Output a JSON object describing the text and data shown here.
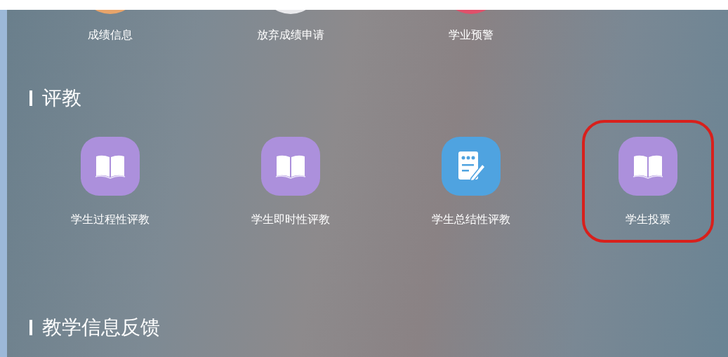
{
  "top_items": [
    {
      "label": "成绩信息",
      "color": "#e8a46a"
    },
    {
      "label": "放弃成绩申请",
      "color": "#e9e9ec"
    },
    {
      "label": "学业预警",
      "color": "#e0506a"
    }
  ],
  "sections": [
    {
      "title": "评教",
      "items": [
        {
          "label": "学生过程性评教",
          "kind": "book",
          "color": "#ac90dc",
          "highlighted": false
        },
        {
          "label": "学生即时性评教",
          "kind": "book",
          "color": "#ac90dc",
          "highlighted": false
        },
        {
          "label": "学生总结性评教",
          "kind": "form",
          "color": "#4fa3e0",
          "highlighted": false
        },
        {
          "label": "学生投票",
          "kind": "book",
          "color": "#ac90dc",
          "highlighted": true
        }
      ]
    },
    {
      "title": "教学信息反馈"
    }
  ]
}
